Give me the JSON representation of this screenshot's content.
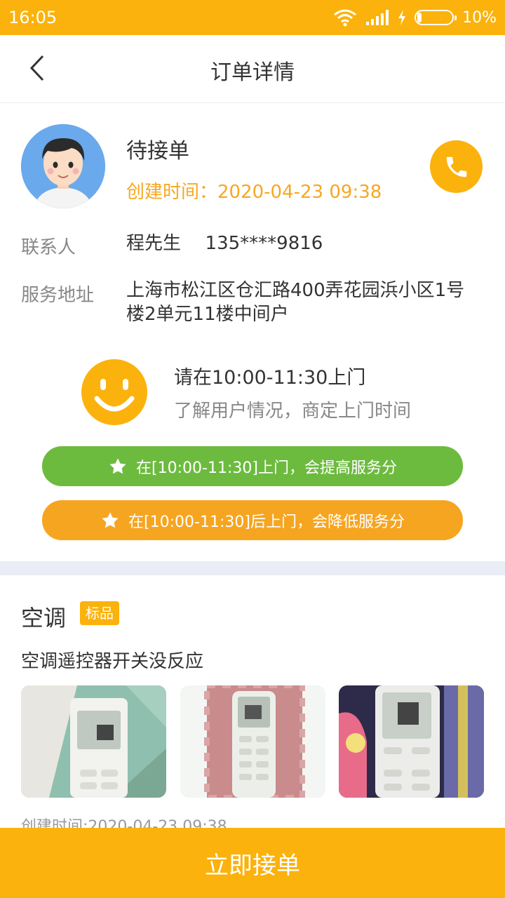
{
  "status_bar": {
    "time": "16:05",
    "battery": "10%",
    "battery_level": 0.1
  },
  "header": {
    "title": "订单详情"
  },
  "order": {
    "status": "待接单",
    "created_label": "创建时间：2020-04-23 09:38",
    "contact_label": "联系人",
    "contact_name": "程先生",
    "contact_phone": "135****9816",
    "address_label": "服务地址",
    "address": "上海市松江区仓汇路400弄花园浜小区1号楼2单元11楼中间户"
  },
  "visit": {
    "title": "请在10:00-11:30上门",
    "subtitle": "了解用户情况，商定上门时间"
  },
  "tips": {
    "green": "在[10:00-11:30]上门，会提高服务分",
    "orange": "在[10:00-11:30]后上门，会降低服务分"
  },
  "product": {
    "name": "空调",
    "tag": "标品",
    "problem": "空调遥控器开关没反应",
    "photos": [
      "remote-photo-1",
      "remote-photo-2",
      "remote-photo-3"
    ],
    "created_time": "创建时间:2020-04-23 09:38"
  },
  "actions": {
    "accept": "立即接单"
  },
  "colors": {
    "brand": "#fbb20c",
    "green": "#6cbb3f",
    "orange": "#f6a521",
    "accent_text": "#f6a821"
  }
}
